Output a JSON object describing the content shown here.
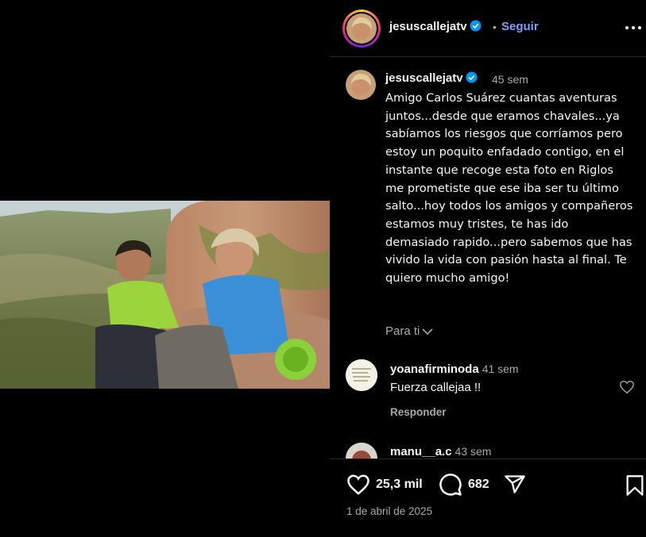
{
  "post": {
    "username": "jesuscallejatv",
    "follow_label": "Seguir",
    "separator": "•",
    "caption_time": "45 sem",
    "caption": "Amigo Carlos Suárez cuantas aventuras juntos...desde que eramos chavales...ya sabíamos los riesgos que corríamos pero estoy un poquito enfadado contigo, en el instante que recoge esta foto en Riglos me prometiste que ese iba ser tu último salto...hoy todos los amigos y compañeros estamos muy tristes, te has ido demasiado rapido...pero sabemos que has vivido la vida con pasión hasta al final. Te quiero mucho amigo!",
    "for_you_label": "Para ti",
    "likes": "25,3 mil",
    "comments_count": "682",
    "date": "1 de abril de 2025"
  },
  "comments": [
    {
      "username": "yoanafirminoda",
      "time": "41 sem",
      "text": "Fuerza callejaa !!",
      "reply_label": "Responder"
    },
    {
      "username": "manu__a.c",
      "time": "43 sem"
    }
  ],
  "colors": {
    "background": "#000000",
    "link": "#859df9",
    "muted": "#a8a8a8",
    "verified": "#0095f6"
  },
  "icons": [
    "more-options-icon",
    "verified-icon",
    "heart-icon",
    "comment-icon",
    "share-icon",
    "bookmark-icon",
    "chevron-down-icon"
  ]
}
